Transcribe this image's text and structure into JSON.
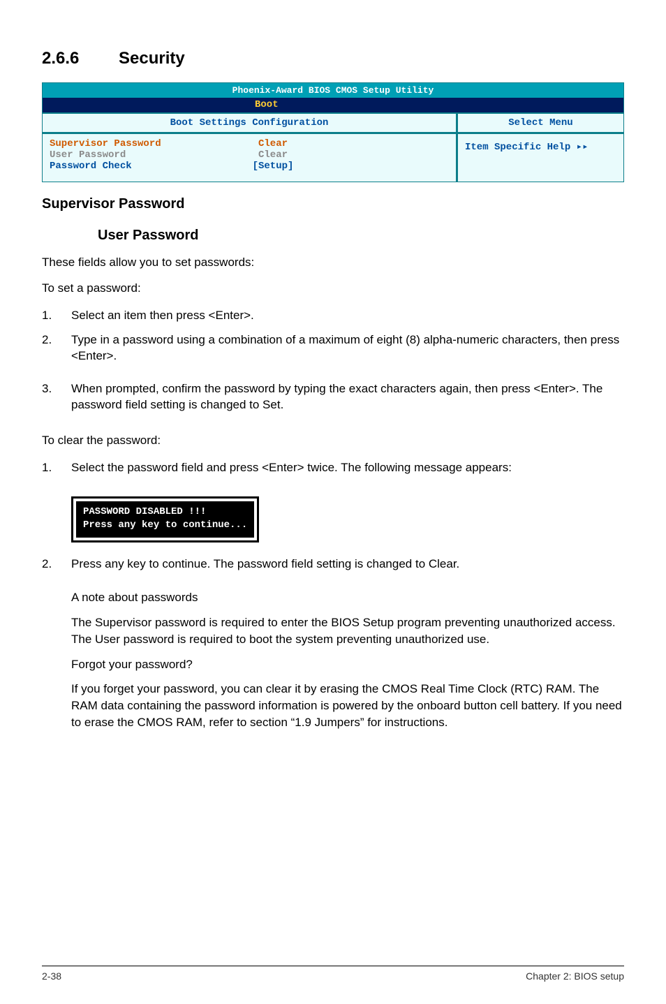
{
  "section": {
    "number": "2.6.6",
    "title": "Security"
  },
  "bios": {
    "titlebar": "Phoenix-Award BIOS CMOS Setup Utility",
    "tab": "Boot",
    "left_header": "Boot Settings Configuration",
    "right_header": "Select Menu",
    "rows": [
      {
        "label": "Supervisor Password",
        "value": "Clear",
        "cls": "sel"
      },
      {
        "label": "User Password",
        "value": "Clear",
        "cls": "dim"
      },
      {
        "label": "Password Check",
        "value": "[Setup]",
        "cls": "reg"
      }
    ],
    "help": "Item Specific Help "
  },
  "supervisor_heading": "Supervisor Password",
  "user_heading": "User Password",
  "intro1": "These fields allow you to set passwords:",
  "intro2": "To set a password:",
  "set_steps": [
    "Select an item then press <Enter>.",
    "Type in a password using a combination of a maximum of eight (8) alpha-numeric characters, then press <Enter>.",
    "When prompted, confirm the password by typing the exact characters again, then press <Enter>. The password field setting is changed to Set."
  ],
  "clear_intro": "To clear the password:",
  "clear_step1": "Select the password field and press <Enter> twice. The following message appears:",
  "msg_line1": "PASSWORD DISABLED !!!",
  "msg_line2": "Press any key to continue...",
  "clear_step2": "Press any key to continue. The password field setting is changed to Clear.",
  "note_heading": "A note about passwords",
  "note_body": "The Supervisor password is required to enter the BIOS Setup program preventing unauthorized access. The User password is required to boot the system preventing unauthorized use.",
  "forgot_heading": "Forgot your password?",
  "forgot_body": "If you forget your password, you can clear it by erasing the CMOS Real Time Clock (RTC) RAM. The RAM data containing the password information is powered by the onboard button cell battery. If you need to erase the CMOS RAM, refer to section “1.9 Jumpers” for instructions.",
  "footer": {
    "left": "2-38",
    "right": "Chapter 2: BIOS setup"
  }
}
